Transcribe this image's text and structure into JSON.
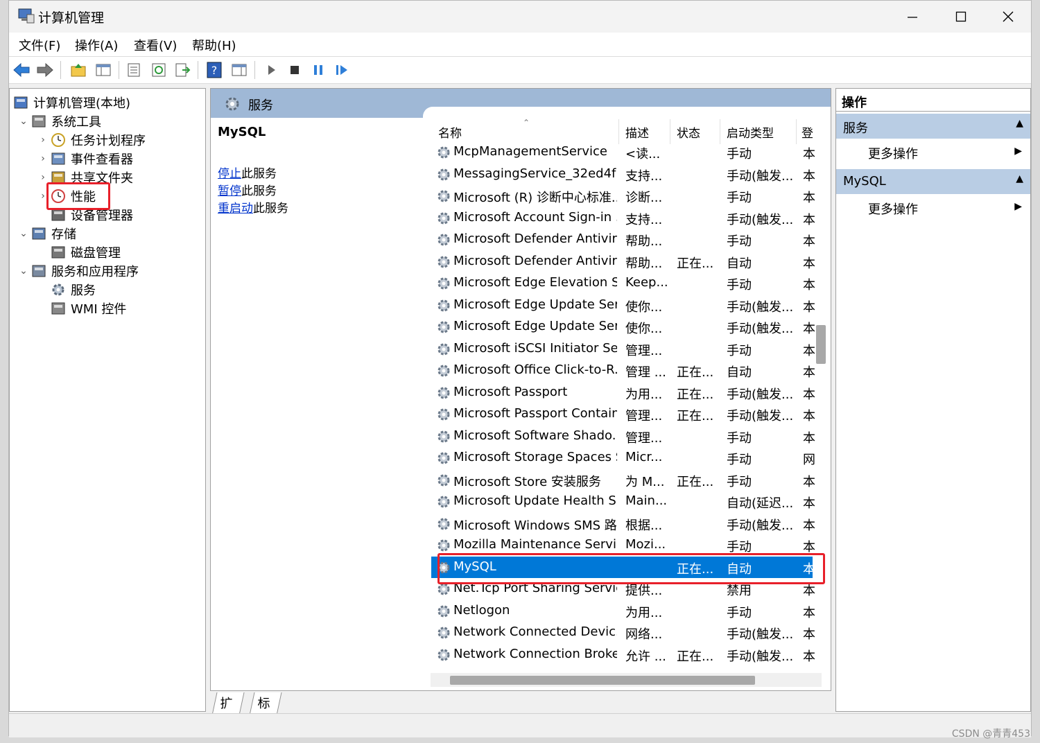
{
  "window": {
    "title": "计算机管理"
  },
  "menu": [
    "文件(F)",
    "操作(A)",
    "查看(V)",
    "帮助(H)"
  ],
  "tree": [
    {
      "label": "计算机管理(本地)",
      "indent": 0,
      "chevron": "",
      "icon": "computer-management-icon"
    },
    {
      "label": "系统工具",
      "indent": 1,
      "chevron": "⌄",
      "icon": "system-tools-icon"
    },
    {
      "label": "任务计划程序",
      "indent": 2,
      "chevron": "›",
      "icon": "clock-icon"
    },
    {
      "label": "事件查看器",
      "indent": 2,
      "chevron": "›",
      "icon": "event-viewer-icon"
    },
    {
      "label": "共享文件夹",
      "indent": 2,
      "chevron": "›",
      "icon": "shared-folder-icon"
    },
    {
      "label": "性能",
      "indent": 2,
      "chevron": "›",
      "icon": "performance-icon"
    },
    {
      "label": "设备管理器",
      "indent": 2,
      "chevron": "",
      "icon": "device-manager-icon"
    },
    {
      "label": "存储",
      "indent": 1,
      "chevron": "⌄",
      "icon": "storage-icon"
    },
    {
      "label": "磁盘管理",
      "indent": 2,
      "chevron": "",
      "icon": "disk-icon"
    },
    {
      "label": "服务和应用程序",
      "indent": 1,
      "chevron": "⌄",
      "icon": "services-apps-icon"
    },
    {
      "label": "服务",
      "indent": 2,
      "chevron": "",
      "icon": "gear-icon"
    },
    {
      "label": "WMI 控件",
      "indent": 2,
      "chevron": "",
      "icon": "wmi-icon"
    }
  ],
  "middle": {
    "header": "服务",
    "selected_service": "MySQL",
    "links": [
      {
        "link": "停止",
        "rest": "此服务"
      },
      {
        "link": "暂停",
        "rest": "此服务"
      },
      {
        "link": "重启动",
        "rest": "此服务"
      }
    ],
    "columns": [
      "名称",
      "描述",
      "状态",
      "启动类型",
      "登"
    ],
    "rows": [
      [
        "McpManagementService",
        "<读...",
        "",
        "手动",
        "本"
      ],
      [
        "MessagingService_32ed4f",
        "支持...",
        "",
        "手动(触发...",
        "本"
      ],
      [
        "Microsoft (R) 诊断中心标准...",
        "诊断...",
        "",
        "手动",
        "本"
      ],
      [
        "Microsoft Account Sign-in ...",
        "支持...",
        "",
        "手动(触发...",
        "本"
      ],
      [
        "Microsoft Defender Antivir...",
        "帮助...",
        "",
        "手动",
        "本"
      ],
      [
        "Microsoft Defender Antivir...",
        "帮助...",
        "正在...",
        "自动",
        "本"
      ],
      [
        "Microsoft Edge Elevation S...",
        "Keep...",
        "",
        "手动",
        "本"
      ],
      [
        "Microsoft Edge Update Ser...",
        "使你...",
        "",
        "手动(触发...",
        "本"
      ],
      [
        "Microsoft Edge Update Ser...",
        "使你...",
        "",
        "手动(触发...",
        "本"
      ],
      [
        "Microsoft iSCSI Initiator Ser...",
        "管理...",
        "",
        "手动",
        "本"
      ],
      [
        "Microsoft Office Click-to-R...",
        "管理 ...",
        "正在...",
        "自动",
        "本"
      ],
      [
        "Microsoft Passport",
        "为用...",
        "正在...",
        "手动(触发...",
        "本"
      ],
      [
        "Microsoft Passport Container",
        "管理...",
        "正在...",
        "手动(触发...",
        "本"
      ],
      [
        "Microsoft Software Shado...",
        "管理...",
        "",
        "手动",
        "本"
      ],
      [
        "Microsoft Storage Spaces S...",
        "Micr...",
        "",
        "手动",
        "网"
      ],
      [
        "Microsoft Store 安装服务",
        "为 M...",
        "正在...",
        "手动",
        "本"
      ],
      [
        "Microsoft Update Health S...",
        "Main...",
        "",
        "自动(延迟...",
        "本"
      ],
      [
        "Microsoft Windows SMS 路...",
        "根据...",
        "",
        "手动(触发...",
        "本"
      ],
      [
        "Mozilla Maintenance Service",
        "Mozi...",
        "",
        "手动",
        "本"
      ],
      [
        "MySQL",
        "",
        "正在...",
        "自动",
        "本"
      ],
      [
        "Net.Tcp Port Sharing Service",
        "提供...",
        "",
        "禁用",
        "本"
      ],
      [
        "Netlogon",
        "为用...",
        "",
        "手动",
        "本"
      ],
      [
        "Network Connected Devic...",
        "网络...",
        "",
        "手动(触发...",
        "本"
      ],
      [
        "Network Connection Broker",
        "允许 ...",
        "正在...",
        "手动(触发...",
        "本"
      ]
    ],
    "selected_row_index": 19,
    "tabs": [
      "扩展",
      "标准"
    ]
  },
  "right": {
    "title": "操作",
    "sections": [
      {
        "title": "服务",
        "item": "更多操作"
      },
      {
        "title": "MySQL",
        "item": "更多操作"
      }
    ]
  },
  "watermark": "CSDN @青青453",
  "colors": {
    "selection": "#0078d7",
    "highlight_box": "#e8202a",
    "header": "#9fb8d6",
    "section": "#b9cde4"
  }
}
